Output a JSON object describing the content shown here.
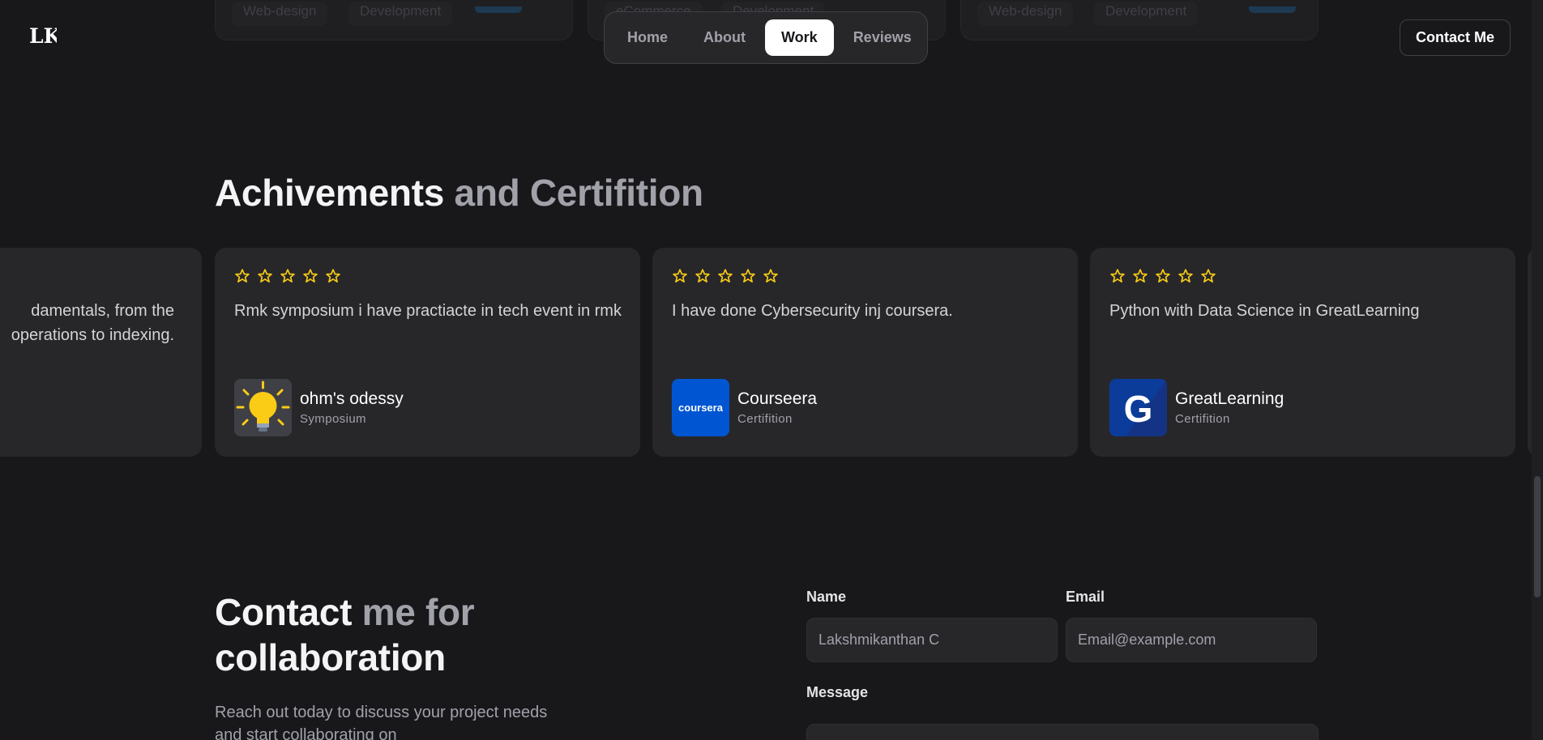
{
  "top_cards": {
    "left_tags": [
      "Web-design",
      "Development"
    ],
    "middle_tags": [
      "eCommerce",
      "Development"
    ],
    "right_tags": [
      "Web-design",
      "Development"
    ]
  },
  "header": {
    "logo_text": "LK",
    "nav": [
      "Home",
      "About",
      "Work",
      "Reviews"
    ],
    "active_nav": "Work",
    "contact_label": "Contact Me"
  },
  "achievements": {
    "title_strong": "Achivements",
    "title_muted": "and Certifition",
    "partial_card_text": [
      "damentals, from the",
      "operations to indexing."
    ],
    "cards": [
      {
        "stars": 5,
        "text": "Rmk symposium i have practiacte in tech event in rmk",
        "org_name": "ohm's odessy",
        "org_type": "Symposium",
        "logo": "lightbulb-icon"
      },
      {
        "stars": 5,
        "text": "I have done Cybersecurity inj coursera.",
        "org_name": "Courseera",
        "org_type": "Certifition",
        "logo_text": "coursera"
      },
      {
        "stars": 5,
        "text": "Python with Data Science in GreatLearning",
        "org_name": "GreatLearning",
        "org_type": "Certifition",
        "logo_text": "G"
      }
    ]
  },
  "contact": {
    "title_strong": "Contact",
    "title_muted": "me for",
    "title_line2": "collaboration",
    "subtitle": "Reach out today to discuss your project needs and start collaborating on",
    "name_label": "Name",
    "name_value": "Lakshmikanthan C",
    "email_label": "Email",
    "email_placeholder": "Email@example.com",
    "message_label": "Message"
  },
  "colors": {
    "background": "#18181b",
    "card": "#27272a",
    "star": "#facc15",
    "coursera_blue": "#0056d2",
    "greatlearning_blue": "#0c3c9a"
  }
}
